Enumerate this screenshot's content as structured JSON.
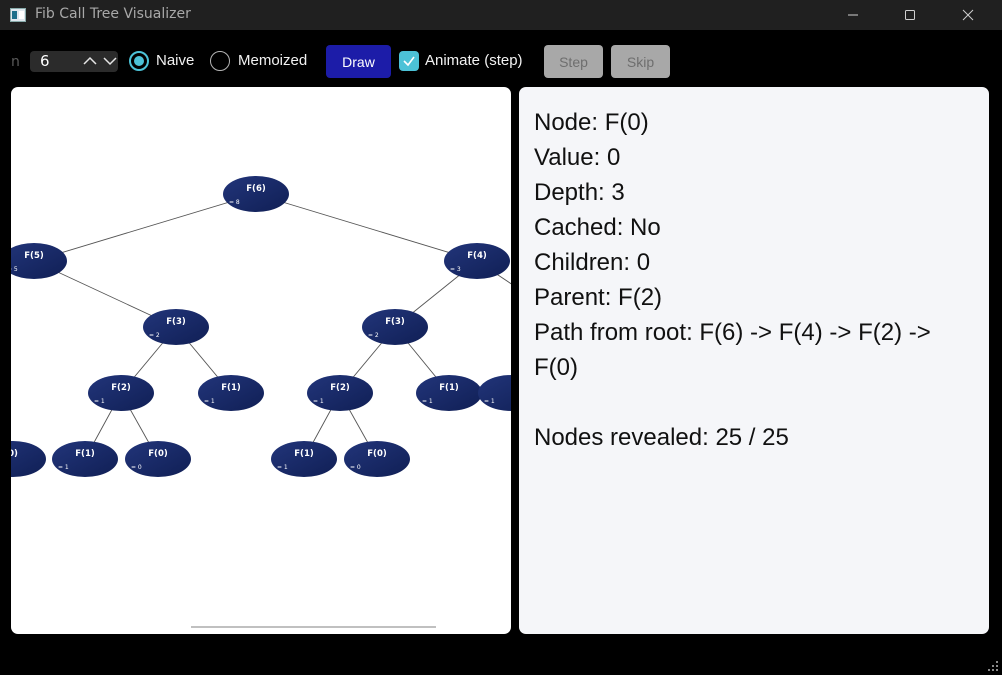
{
  "window": {
    "title": "Fib Call Tree Visualizer"
  },
  "toolbar": {
    "n_label": "n",
    "n_value": "6",
    "naive_label": "Naive",
    "memo_label": "Memoized",
    "mode_selected": "Naive",
    "draw_label": "Draw",
    "animate_label": "Animate (step)",
    "animate_checked": true,
    "step_label": "Step",
    "skip_label": "Skip"
  },
  "colors": {
    "accent": "#4cc2d7",
    "draw_button": "#1c1ca8",
    "node_fill_start": "#1d2f66",
    "node_fill_end": "#0f1e52",
    "panel_bg": "#f5f6f9"
  },
  "tree": {
    "nodes": [
      {
        "id": "n0",
        "label": "F(6)",
        "value": "8"
      },
      {
        "id": "n1",
        "label": "F(5)",
        "value": "5"
      },
      {
        "id": "n2",
        "label": "F(4)",
        "value": "3"
      },
      {
        "id": "n3",
        "label": "F(3)",
        "value": "2"
      },
      {
        "id": "n4",
        "label": "F(3)",
        "value": "2"
      },
      {
        "id": "n5",
        "label": "F(2)",
        "value": "1"
      },
      {
        "id": "n6",
        "label": "F(1)",
        "value": "1"
      },
      {
        "id": "n7",
        "label": "F(2)",
        "value": "1"
      },
      {
        "id": "n8",
        "label": "F(1)",
        "value": "1"
      },
      {
        "id": "n9",
        "label": "",
        "value": "1"
      },
      {
        "id": "n10",
        "label": "0)",
        "value": ""
      },
      {
        "id": "n11",
        "label": "F(1)",
        "value": "1"
      },
      {
        "id": "n12",
        "label": "F(0)",
        "value": "0"
      },
      {
        "id": "n13",
        "label": "F(1)",
        "value": "1"
      },
      {
        "id": "n14",
        "label": "F(0)",
        "value": "0"
      }
    ]
  },
  "info": {
    "lines": [
      "Node: F(0)",
      "Value: 0",
      "Depth: 3",
      "Cached: No",
      "Children: 0",
      "Parent: F(2)",
      "Path from root: F(6) -> F(4) -> F(2) ->",
      "F(0)"
    ],
    "revealed": "Nodes revealed: 25 / 25"
  }
}
